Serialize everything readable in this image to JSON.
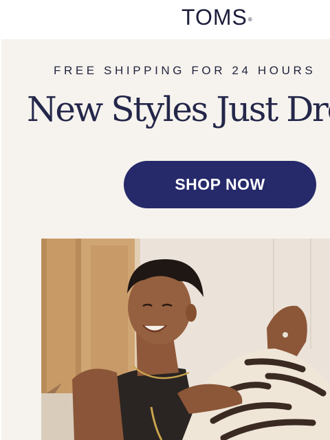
{
  "header": {
    "brand": "TOMS"
  },
  "promo": {
    "shipping_text": "FREE SHIPPING FOR 24 HOURS",
    "headline": "New Styles Just Dropped",
    "cta_label": "SHOP NOW"
  },
  "colors": {
    "brand_navy": "#262a6a",
    "panel_bg": "#f6f3ee",
    "text_dark": "#22243e"
  }
}
